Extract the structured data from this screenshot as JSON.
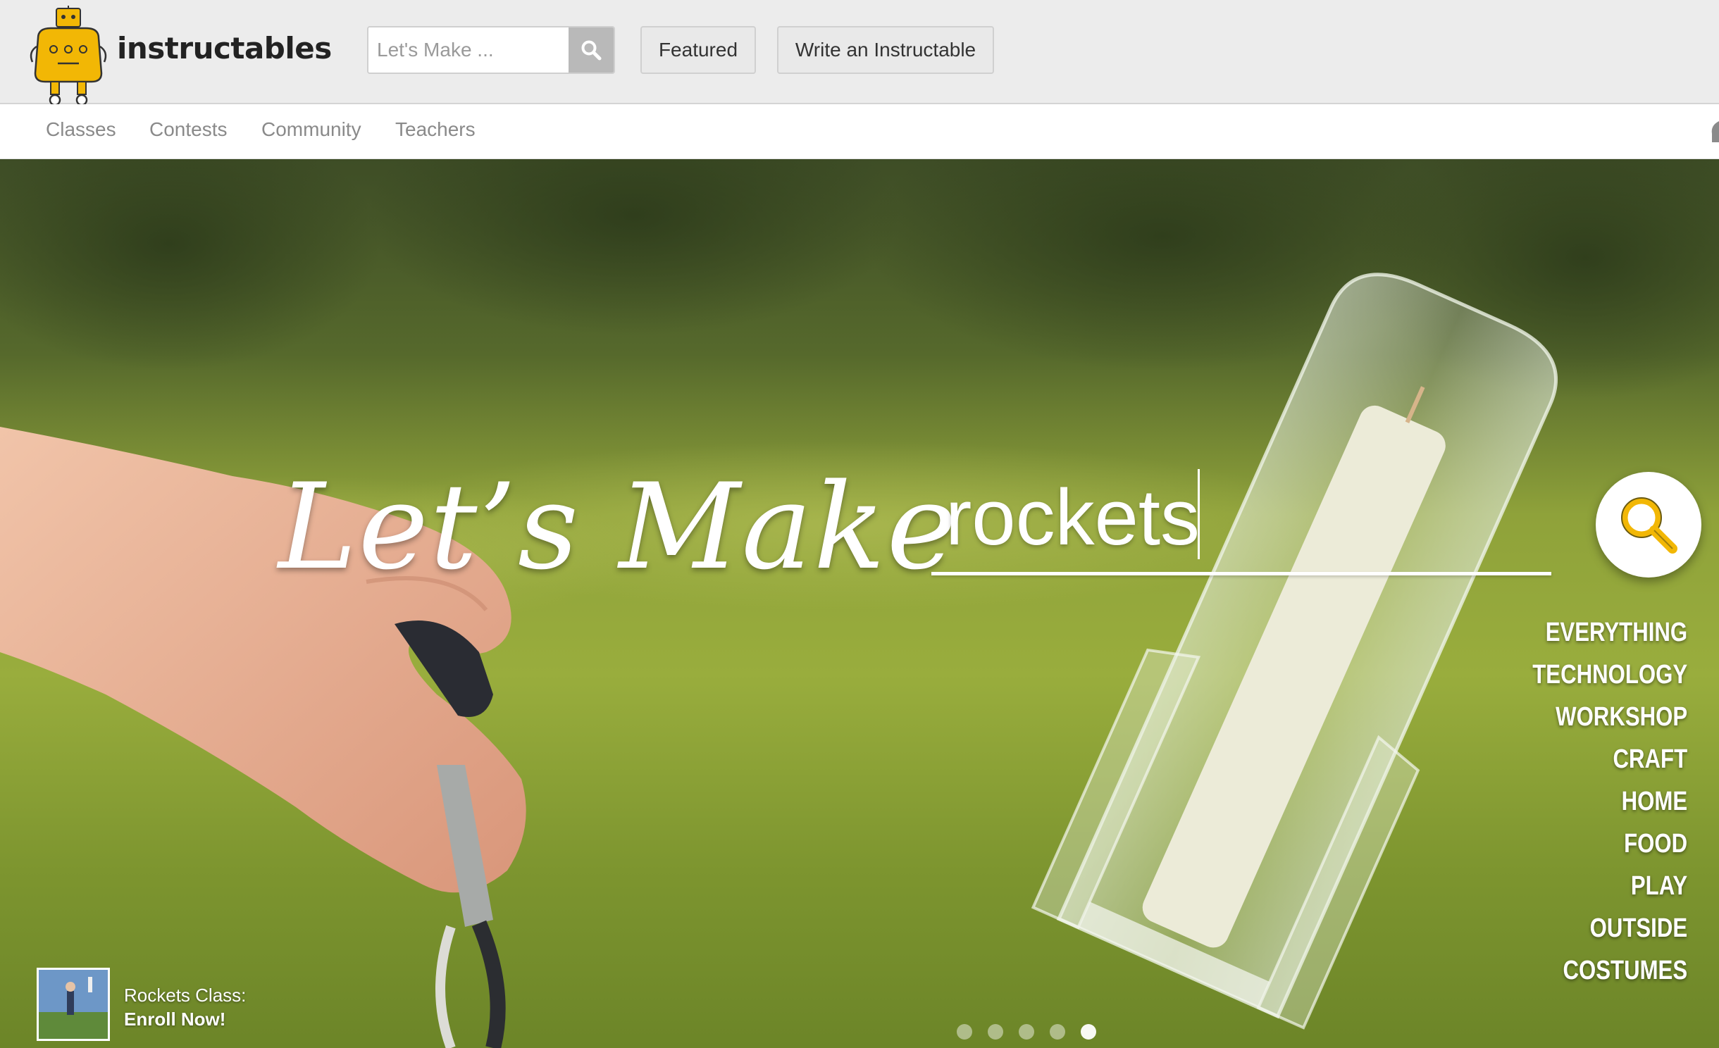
{
  "header": {
    "logo_text": "instructables",
    "search": {
      "placeholder": "Let's Make ...",
      "value": ""
    },
    "buttons": {
      "featured": "Featured",
      "write": "Write an Instructable"
    }
  },
  "subnav": {
    "items": [
      "Classes",
      "Contests",
      "Community",
      "Teachers"
    ]
  },
  "hero": {
    "headline": "Let’s Make",
    "query": "rockets",
    "categories": [
      "EVERYTHING",
      "TECHNOLOGY",
      "WORKSHOP",
      "CRAFT",
      "HOME",
      "FOOD",
      "PLAY",
      "OUTSIDE",
      "COSTUMES"
    ],
    "promo": {
      "line1": "Rockets Class:",
      "line2": "Enroll Now!"
    },
    "carousel": {
      "total_slides": 5,
      "active_slide": 5
    }
  },
  "colors": {
    "header_bg": "#ececec",
    "nav_text": "#8a8a8a",
    "search_button": "#b9b9b9",
    "hero_overlay_text": "#ffffff",
    "logo_yellow": "#f2b705"
  },
  "icons": {
    "logo": "robot-mascot-icon",
    "search": "magnifier-icon",
    "hero_search": "magnifier-icon"
  }
}
